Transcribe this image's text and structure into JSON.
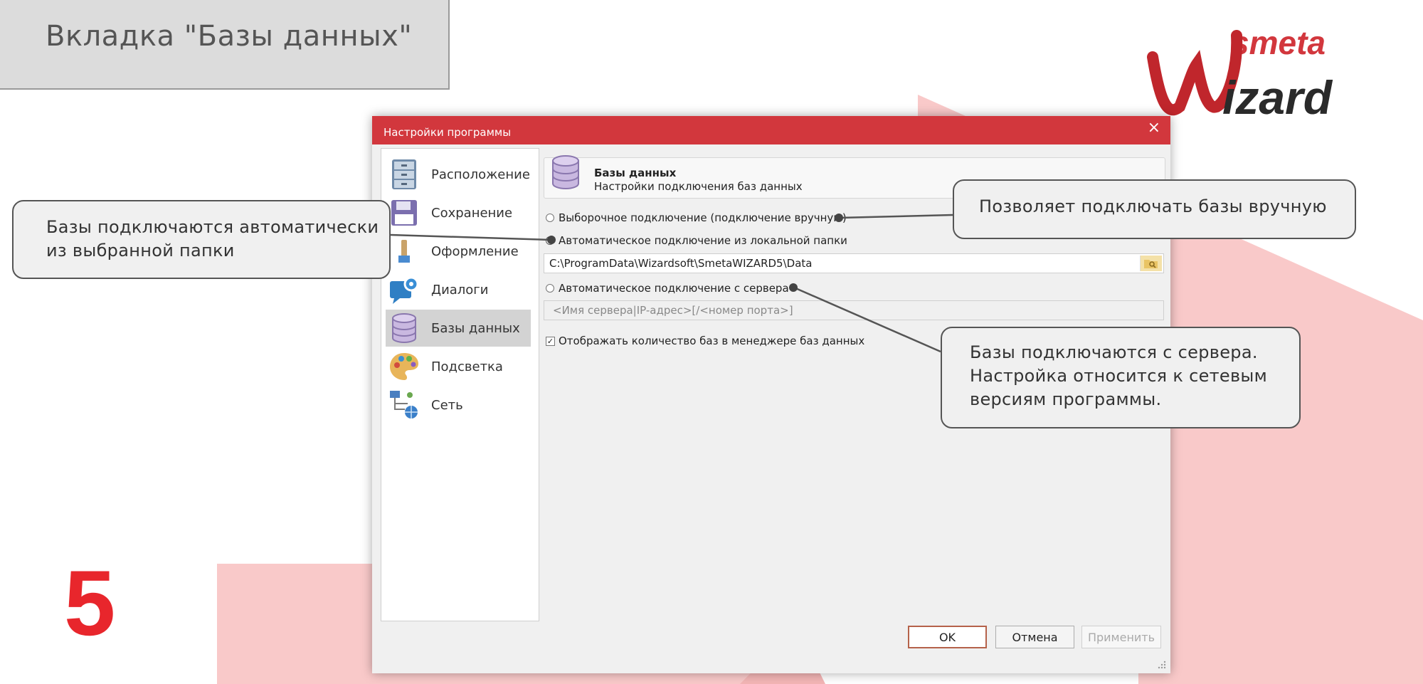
{
  "slide": {
    "title": "Вкладка \"Базы данных\"",
    "page_number": "5",
    "logo_words": [
      "smeta",
      "Wizard"
    ]
  },
  "window": {
    "title": "Настройки программы",
    "close_glyph": "×"
  },
  "nav": {
    "items": [
      {
        "label": "Расположение",
        "icon": "cabinet-icon"
      },
      {
        "label": "Сохранение",
        "icon": "floppy-icon"
      },
      {
        "label": "Оформление",
        "icon": "paint-icon"
      },
      {
        "label": "Диалоги",
        "icon": "dialog-gear-icon"
      },
      {
        "label": "Базы данных",
        "icon": "database-icon",
        "selected": true
      },
      {
        "label": "Подсветка",
        "icon": "palette-icon"
      },
      {
        "label": "Сеть",
        "icon": "network-icon"
      }
    ]
  },
  "panel": {
    "header_title": "Базы данных",
    "header_subtitle": "Настройки подключения баз данных",
    "option_manual": "Выборочное подключение (подключение вручную)",
    "option_local": "Автоматическое подключение из локальной папки",
    "local_path": "C:\\ProgramData\\Wizardsoft\\SmetaWIZARD5\\Data",
    "option_server": "Автоматическое подключение с сервера",
    "server_placeholder": "<Имя сервера|IP-адрес>[/<номер порта>]",
    "show_count_label": "Отображать количество баз в менеджере баз данных",
    "show_count_checked": true,
    "selected_option": "local"
  },
  "buttons": {
    "ok": "OK",
    "cancel": "Отмена",
    "apply": "Применить"
  },
  "callouts": {
    "auto_folder": [
      "Базы подключаются автоматически",
      "из выбранной папки"
    ],
    "manual": [
      "Позволяет подключать базы вручную"
    ],
    "server": [
      "Базы подключаются с сервера.",
      "Настройка относится к сетевым",
      "версиям программы."
    ]
  },
  "colors": {
    "accent_red": "#d2373d",
    "slide_pink": "#f9c9c9",
    "number_red": "#e8262c"
  }
}
